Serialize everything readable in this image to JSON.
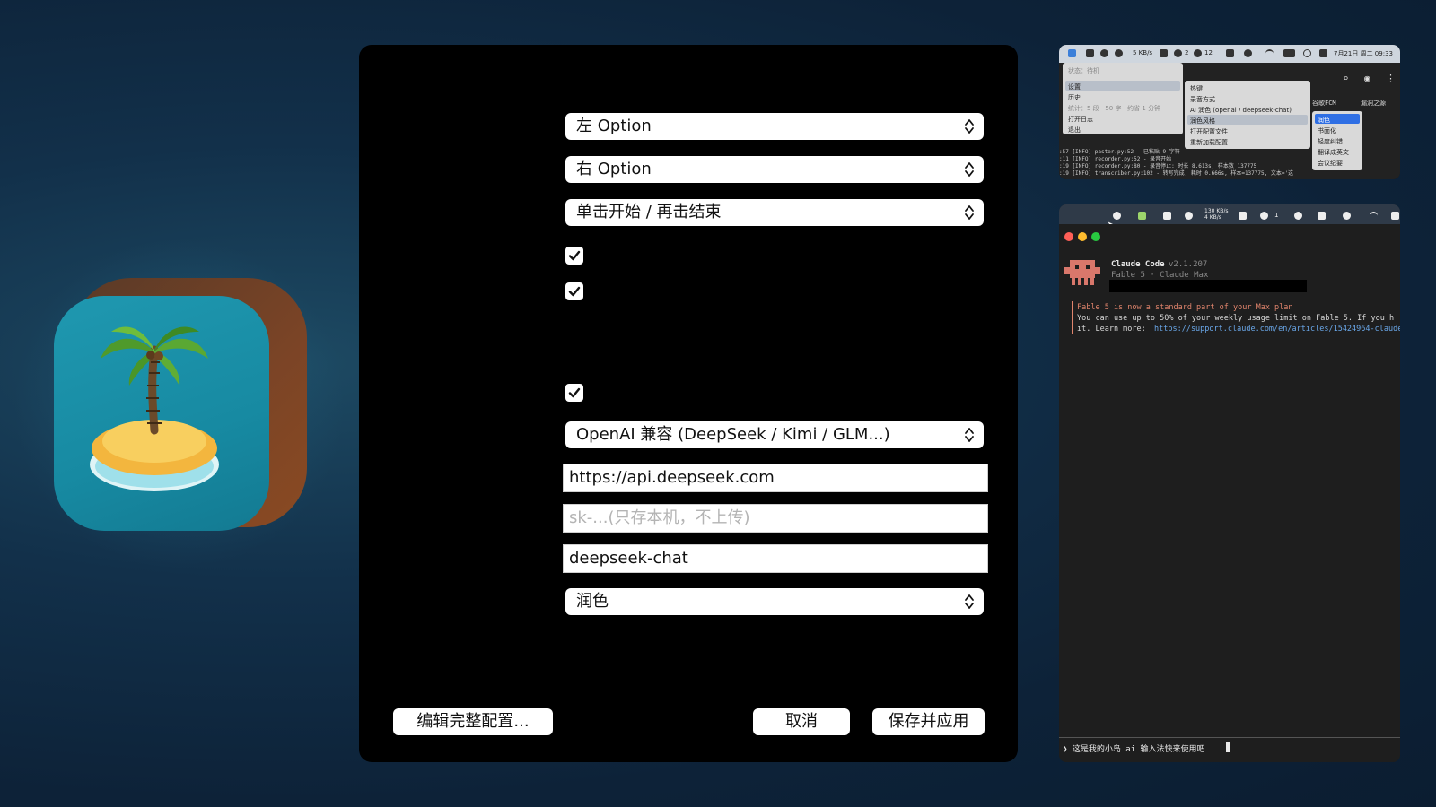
{
  "settings": {
    "hotkey_left": "左 Option",
    "hotkey_right": "右 Option",
    "record_mode": "单击开始 / 再击结束",
    "checkbox_1_checked": true,
    "checkbox_2_checked": true,
    "checkbox_3_checked": true,
    "provider": "OpenAI 兼容 (DeepSeek / Kimi / GLM...)",
    "base_url": "https://api.deepseek.com",
    "api_key_placeholder": "sk-...(只存本机，不上传)",
    "model": "deepseek-chat",
    "style": "润色",
    "edit_config_label": "编辑完整配置...",
    "cancel_label": "取消",
    "save_label": "保存并应用"
  },
  "thumb_top": {
    "menubar_speed": "5 KB/s",
    "menubar_count1": "2",
    "menubar_count2": "12",
    "menubar_datetime": "7月21日 周二 09:33",
    "status": "状态：待机",
    "menu_items": [
      "设置",
      "历史",
      "统计：5 段 · 50 字 · 约省 1 分钟",
      "打开日志",
      "退出"
    ],
    "submenu_items": [
      "热键",
      "录音方式",
      "AI 润色 (openai / deepseek-chat)",
      "润色风格",
      "打开配置文件",
      "重新加载配置"
    ],
    "style_items": [
      "润色",
      "书面化",
      "轻度纠错",
      "翻译成英文",
      "会议纪要"
    ],
    "right_label_1": "谷歌FCM",
    "right_label_2": "漏洞之源",
    "log_lines": [
      ":57 [INFO] paster.py:52 - 已粘贴 9 字符",
      ":11 [INFO] recorder.py:52 - 录音开始",
      ":19 [INFO] recorder.py:80 - 录音停止: 时长 8.613s, 样本数 137775",
      ":19 [INFO] transcriber.py:102 - 转写完成, 耗时 0.666s, 样本=137775, 文本='这"
    ]
  },
  "thumb_bottom": {
    "menubar_speed": "130 KB/s\n4 KB/s",
    "menubar_count": "1",
    "app_name": "Claude Code",
    "version": "v2.1.207",
    "plan": "Fable 5 · Claude Max",
    "notice_title": "Fable 5 is now a standard part of your Max plan",
    "notice_line": "You can use up to 50% of your weekly usage limit on Fable 5. If you h",
    "notice_learn": "it. Learn more:",
    "notice_link": "https://support.claude.com/en/articles/15424964-claude",
    "prompt": "❯ 这是我的小岛 ai 输入法快来使用吧"
  },
  "colors": {
    "background": "#0d2238",
    "window": "#000000",
    "accent_blue": "#2f6fe4",
    "notice_orange": "#e0846c",
    "link_blue": "#6aa7e8"
  },
  "icons": [
    "island-app-icon",
    "select-arrows-icon",
    "checkmark-icon",
    "claude-mascot-icon"
  ]
}
